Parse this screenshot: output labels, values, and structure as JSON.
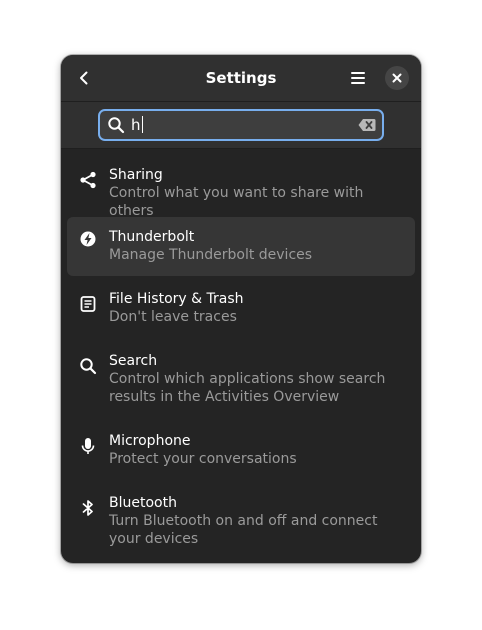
{
  "window": {
    "title": "Settings"
  },
  "search": {
    "value": "h",
    "placeholder": ""
  },
  "results": [
    {
      "icon": "share-icon",
      "title": "Sharing",
      "subtitle": "Control what you want to share with others",
      "selected": false
    },
    {
      "icon": "thunderbolt-icon",
      "title": "Thunderbolt",
      "subtitle": "Manage Thunderbolt devices",
      "selected": true
    },
    {
      "icon": "file-history-icon",
      "title": "File History & Trash",
      "subtitle": "Don't leave traces",
      "selected": false
    },
    {
      "icon": "search-icon",
      "title": "Search",
      "subtitle": "Control which applications show search results in the Activities Overview",
      "selected": false
    },
    {
      "icon": "microphone-icon",
      "title": "Microphone",
      "subtitle": "Protect your conversations",
      "selected": false
    },
    {
      "icon": "bluetooth-icon",
      "title": "Bluetooth",
      "subtitle": "Turn Bluetooth on and off and connect your devices",
      "selected": false
    }
  ],
  "colors": {
    "window_bg": "#242424",
    "headerbar_bg": "#303030",
    "accent": "#78aeed",
    "text": "#ffffff",
    "subtext": "#9a9a9a",
    "selected_row": "#363636"
  }
}
